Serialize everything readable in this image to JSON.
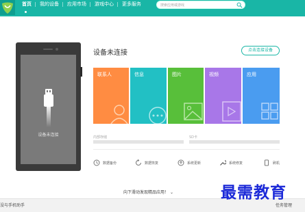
{
  "nav": {
    "items": [
      "首页",
      "我的设备",
      "应用市场",
      "游戏中心",
      "更多服务"
    ],
    "search_placeholder": "搜索应用或游戏"
  },
  "phone": {
    "status": "设备未连接"
  },
  "main": {
    "title": "设备未连接",
    "connect_button": "点击连接设备",
    "tiles": [
      {
        "label": "联系人",
        "color": "#ff8c42"
      },
      {
        "label": "信息",
        "color": "#22c0c4"
      },
      {
        "label": "图片",
        "color": "#58bf3a"
      },
      {
        "label": "视频",
        "color": "#a877e8"
      },
      {
        "label": "应用",
        "color": "#4a9cf0"
      }
    ],
    "storage": {
      "internal": "内部存储",
      "sd": "SD卡"
    },
    "tools": [
      "数据备份",
      "数据恢复",
      "系统更新",
      "系统修复",
      "刷机"
    ],
    "more_apps": "向下滑动发现精品应用！"
  },
  "status_bar": {
    "left": "没与手机助手",
    "right": "任务管理"
  },
  "watermark": "最需教育",
  "colors": {
    "accent": "#19b6a6"
  }
}
